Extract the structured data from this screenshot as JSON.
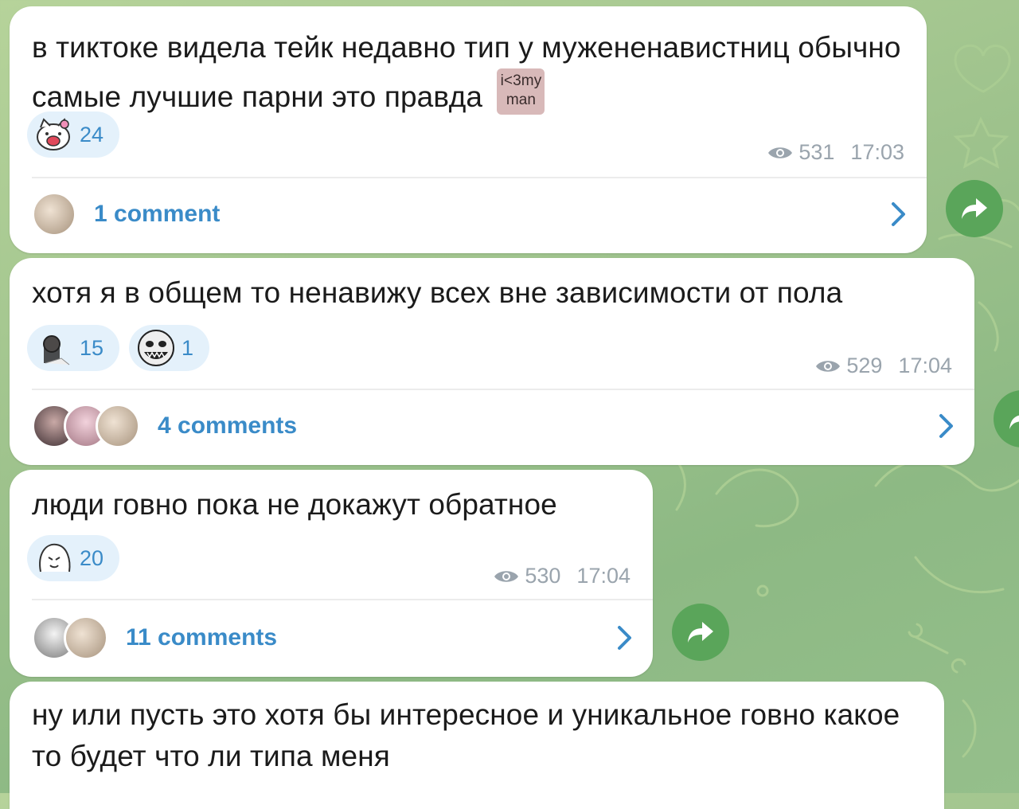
{
  "messages": [
    {
      "text": "в тиктоке видела тейк недавно тип у мужененавистниц обычно самые лучшие парни это правда",
      "sticker": {
        "line1": "i<3my",
        "line2": "man"
      },
      "reactions": [
        {
          "icon": "hello-kitty-emoji-icon",
          "count": "24"
        }
      ],
      "views": "531",
      "time": "17:03",
      "comments_label": "1 comment"
    },
    {
      "text": "хотя я в общем то ненавижу всех вне зависимости от пола",
      "reactions": [
        {
          "icon": "anime-girl-emoji-icon",
          "count": "15"
        },
        {
          "icon": "troll-face-emoji-icon",
          "count": "1"
        }
      ],
      "views": "529",
      "time": "17:04",
      "comments_label": "4 comments"
    },
    {
      "text": "люди говно пока не докажут обратное",
      "reactions": [
        {
          "icon": "shy-face-emoji-icon",
          "count": "20"
        }
      ],
      "views": "530",
      "time": "17:04",
      "comments_label": "11 comments"
    },
    {
      "text": "ну или пусть это хотя бы интересное и уникальное говно какое то будет что ли типа меня"
    }
  ],
  "colors": {
    "accent": "#3a8bc8",
    "share_button": "#5aa55a",
    "reaction_bg": "#e4f1fb",
    "meta_text": "#9aa4ad"
  }
}
